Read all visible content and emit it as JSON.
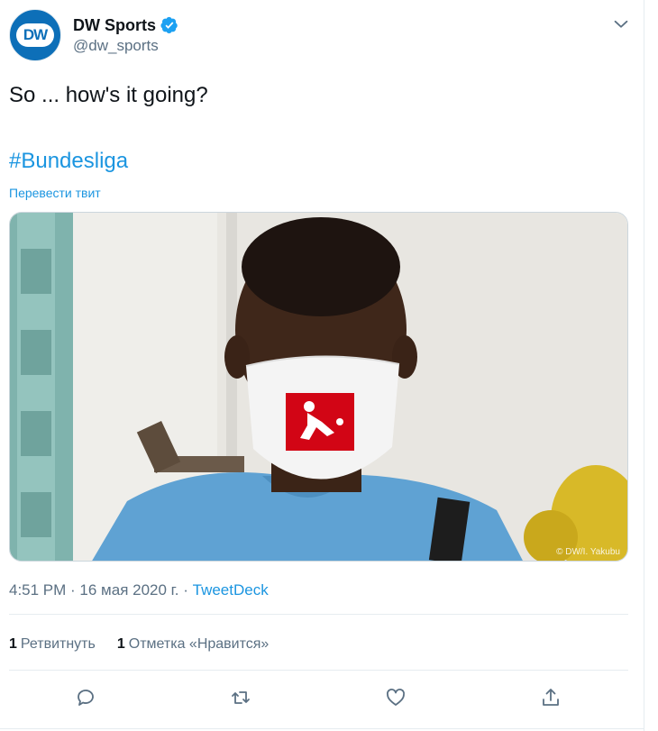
{
  "author": {
    "display_name": "DW Sports",
    "handle": "@dw_sports",
    "avatar_text": "DW",
    "verified": true
  },
  "tweet": {
    "text": "So ... how's it going?",
    "hashtag": "#Bundesliga",
    "translate_label": "Перевести твит",
    "media_credit": "© DW/I. Yakubu"
  },
  "meta": {
    "time": "4:51 PM",
    "separator": " · ",
    "date": "16 мая 2020 г.",
    "source": "TweetDeck"
  },
  "stats": {
    "retweets_count": "1",
    "retweets_label": "Ретвитнуть",
    "likes_count": "1",
    "likes_label": "Отметка «Нравится»"
  },
  "colors": {
    "accent": "#1b95e0",
    "secondary_text": "#5b7083",
    "avatar_bg": "#0d6fb8",
    "mask_logo_red": "#d20515"
  },
  "icons": {
    "verified": "verified-badge-icon",
    "caret": "chevron-down-icon",
    "reply": "reply-icon",
    "retweet": "retweet-icon",
    "like": "heart-icon",
    "share": "share-icon"
  }
}
